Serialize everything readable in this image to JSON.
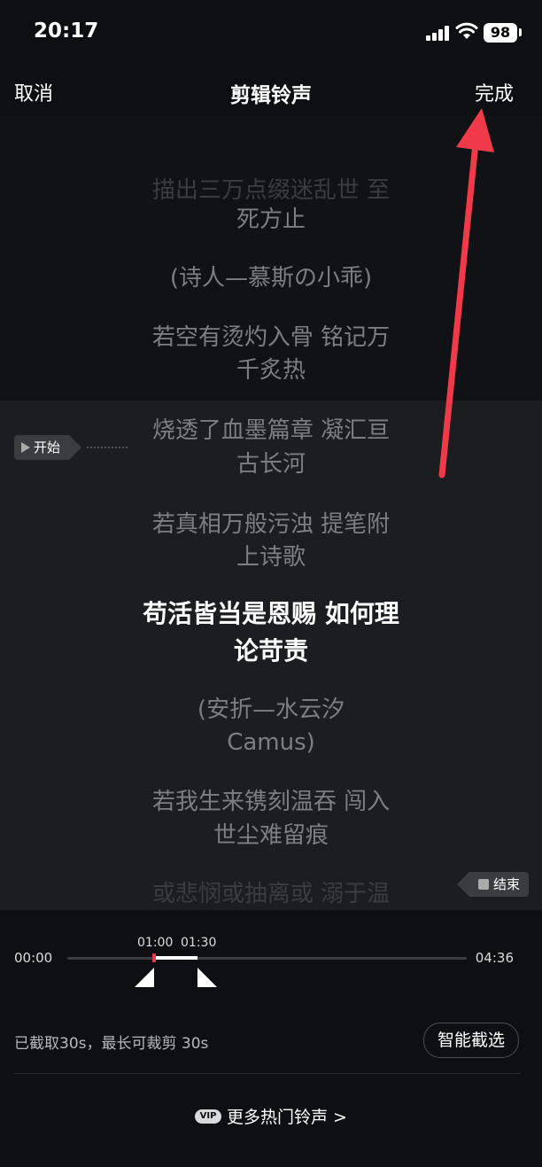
{
  "status": {
    "time": "20:17",
    "battery": "98"
  },
  "nav": {
    "cancel": "取消",
    "title": "剪辑铃声",
    "done": "完成"
  },
  "lyrics": [
    {
      "text": "描出三万点缀迷乱世 至",
      "state": "faded"
    },
    {
      "text": "死方止",
      "state": "dim"
    },
    {
      "text": "(诗人—慕斯の小乖)",
      "state": "dim"
    },
    {
      "text": "若空有烫灼入骨 铭记万",
      "state": "dim"
    },
    {
      "text": "千炙热",
      "state": "dim"
    },
    {
      "text": "烧透了血墨篇章 凝汇亘",
      "state": "dim"
    },
    {
      "text": "古长河",
      "state": "dim"
    },
    {
      "text": "若真相万般污浊 提笔附",
      "state": "dim"
    },
    {
      "text": "上诗歌",
      "state": "dim"
    },
    {
      "text": "苟活皆当是恩赐 如何理",
      "state": "active"
    },
    {
      "text": "论苛责",
      "state": "active"
    },
    {
      "text": "(安折—水云汐",
      "state": "dim"
    },
    {
      "text": "Camus)",
      "state": "dim"
    },
    {
      "text": "若我生来镌刻温吞 闯入",
      "state": "dim"
    },
    {
      "text": "世尘难留痕",
      "state": "dim"
    },
    {
      "text": "或悲悯或抽离或 溺于温",
      "state": "faded"
    }
  ],
  "markers": {
    "start": "开始",
    "end": "结束"
  },
  "timeline": {
    "start": "00:00",
    "end": "04:36",
    "sel_start": "01:00",
    "sel_end": "01:30"
  },
  "clip_info": "已截取30s，最长可裁剪 30s",
  "smart_button": "智能截选",
  "more": {
    "vip": "VIP",
    "label": "更多热门铃声 >"
  },
  "colors": {
    "accent": "#e8394a",
    "annotation_arrow": "#f03a4a"
  }
}
